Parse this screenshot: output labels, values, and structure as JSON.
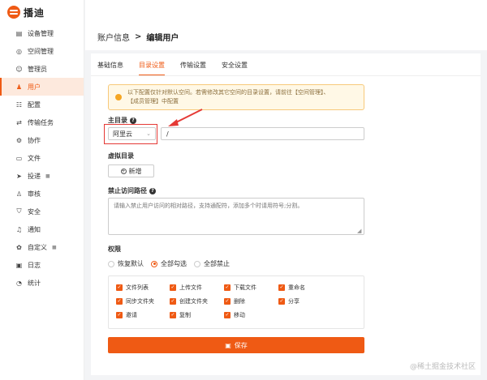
{
  "logo": {
    "text": "播迪"
  },
  "sidebar": {
    "items": [
      {
        "label": "设备管理",
        "icon": "device-icon"
      },
      {
        "label": "空间管理",
        "icon": "space-icon"
      },
      {
        "label": "管理员",
        "icon": "admin-icon"
      },
      {
        "label": "用户",
        "icon": "user-icon",
        "active": true
      },
      {
        "label": "配置",
        "icon": "config-icon"
      },
      {
        "label": "传输任务",
        "icon": "transfer-icon"
      },
      {
        "label": "协作",
        "icon": "collab-icon"
      },
      {
        "label": "文件",
        "icon": "file-icon"
      },
      {
        "label": "投递",
        "icon": "send-icon",
        "locked": true
      },
      {
        "label": "审核",
        "icon": "audit-icon"
      },
      {
        "label": "安全",
        "icon": "shield-icon"
      },
      {
        "label": "通知",
        "icon": "bell-icon"
      },
      {
        "label": "自定义",
        "icon": "custom-icon",
        "locked": true
      },
      {
        "label": "日志",
        "icon": "log-icon"
      },
      {
        "label": "统计",
        "icon": "stats-icon"
      }
    ]
  },
  "breadcrumb": {
    "parent": "账户信息",
    "separator": ">",
    "current": "编辑用户"
  },
  "tabs": [
    {
      "label": "基础信息"
    },
    {
      "label": "目录设置",
      "active": true
    },
    {
      "label": "传输设置"
    },
    {
      "label": "安全设置"
    }
  ],
  "notice": {
    "line1": "以下配置仅针对默认空间。若需修改其它空间的目录设置，请前往【空间管理】、",
    "line2": "【成员管理】中配置"
  },
  "root_dir": {
    "label": "主目录",
    "select_value": "阿里云",
    "path_value": "/"
  },
  "virtual_dir": {
    "label": "虚拟目录",
    "add_label": "新增"
  },
  "forbidden_paths": {
    "label": "禁止访问路径",
    "placeholder": "请输入禁止用户访问的相对路径，支持通配符，添加多个时请用符号;分割。"
  },
  "permissions": {
    "label": "权限",
    "radios": [
      {
        "label": "恢复默认",
        "selected": false
      },
      {
        "label": "全部勾选",
        "selected": true
      },
      {
        "label": "全部禁止",
        "selected": false
      }
    ],
    "items": [
      {
        "label": "文件列表",
        "checked": true
      },
      {
        "label": "上传文件",
        "checked": true
      },
      {
        "label": "下载文件",
        "checked": true
      },
      {
        "label": "重命名",
        "checked": true
      },
      {
        "label": "同步文件夹",
        "checked": true
      },
      {
        "label": "创建文件夹",
        "checked": true
      },
      {
        "label": "删除",
        "checked": true
      },
      {
        "label": "分享",
        "checked": true
      },
      {
        "label": "邀请",
        "checked": true
      },
      {
        "label": "复制",
        "checked": true
      },
      {
        "label": "移动",
        "checked": true
      }
    ]
  },
  "save_label": "保存",
  "watermark": "@稀土掘金技术社区",
  "colors": {
    "accent": "#ef5a14",
    "highlight_box": "#e53935",
    "notice_bg": "#fff8e6"
  }
}
